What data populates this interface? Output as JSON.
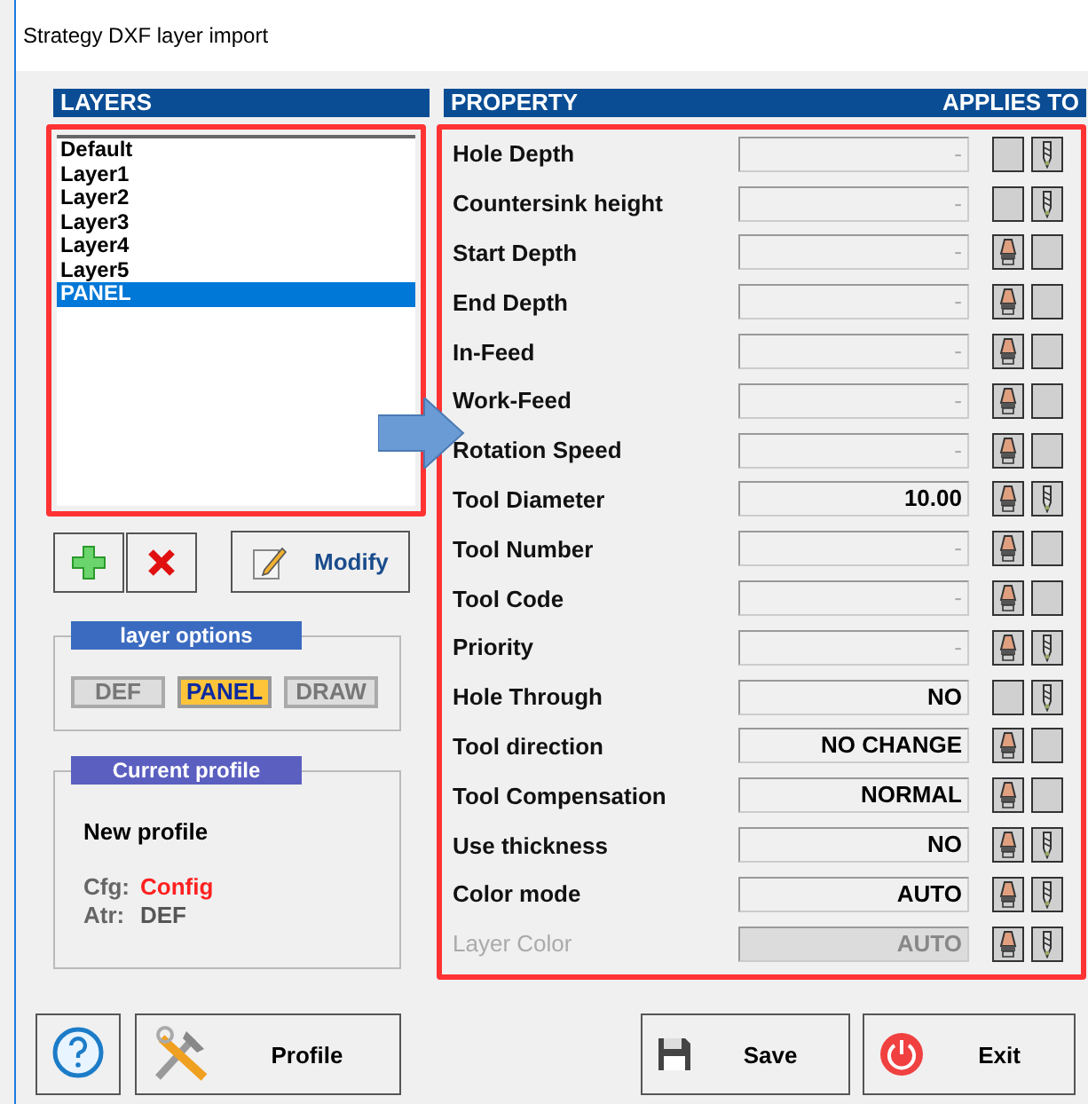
{
  "window": {
    "title": "Strategy DXF layer import"
  },
  "layers": {
    "header": "LAYERS",
    "items": [
      {
        "label": "Default",
        "selected": false
      },
      {
        "label": "Layer1",
        "selected": false
      },
      {
        "label": "Layer2",
        "selected": false
      },
      {
        "label": "Layer3",
        "selected": false
      },
      {
        "label": "Layer4",
        "selected": false
      },
      {
        "label": "Layer5",
        "selected": false
      },
      {
        "label": "PANEL",
        "selected": true
      }
    ]
  },
  "layer_buttons": {
    "modify": "Modify"
  },
  "layer_options": {
    "title": "layer options",
    "options": [
      {
        "label": "DEF",
        "selected": false
      },
      {
        "label": "PANEL",
        "selected": true
      },
      {
        "label": "DRAW",
        "selected": false
      }
    ]
  },
  "current_profile": {
    "title": "Current profile",
    "name": "New profile",
    "fields": [
      {
        "label": "Cfg:",
        "value": "Config",
        "color": "#ff2020"
      },
      {
        "label": "Atr:",
        "value": "DEF",
        "color": "#555555"
      }
    ]
  },
  "properties": {
    "header": "PROPERTY",
    "applies_header": "APPLIES TO",
    "rows": [
      {
        "label": "Hole Depth",
        "placeholder": "-",
        "panel": false,
        "drill": true,
        "disabled": false
      },
      {
        "label": "Countersink height",
        "placeholder": "-",
        "panel": false,
        "drill": true,
        "disabled": false
      },
      {
        "label": "Start Depth",
        "placeholder": "-",
        "panel": true,
        "drill": false,
        "disabled": false
      },
      {
        "label": "End Depth",
        "placeholder": "-",
        "panel": true,
        "drill": false,
        "disabled": false
      },
      {
        "label": "In-Feed",
        "placeholder": "-",
        "panel": true,
        "drill": false,
        "disabled": false
      },
      {
        "label": "Work-Feed",
        "placeholder": "-",
        "panel": true,
        "drill": false,
        "disabled": false
      },
      {
        "label": "Rotation Speed",
        "placeholder": "-",
        "panel": true,
        "drill": false,
        "disabled": false
      },
      {
        "label": "Tool Diameter",
        "value": "10.00",
        "panel": true,
        "drill": true,
        "disabled": false
      },
      {
        "label": "Tool Number",
        "placeholder": "-",
        "panel": true,
        "drill": false,
        "disabled": false
      },
      {
        "label": "Tool Code",
        "placeholder": "-",
        "panel": true,
        "drill": false,
        "disabled": false
      },
      {
        "label": "Priority",
        "placeholder": "-",
        "panel": true,
        "drill": true,
        "disabled": false
      },
      {
        "label": "Hole Through",
        "value": "NO",
        "panel": false,
        "drill": true,
        "disabled": false
      },
      {
        "label": "Tool direction",
        "value": "NO CHANGE",
        "panel": true,
        "drill": false,
        "disabled": false
      },
      {
        "label": "Tool Compensation",
        "value": "NORMAL",
        "panel": true,
        "drill": false,
        "disabled": false
      },
      {
        "label": "Use thickness",
        "value": "NO",
        "panel": true,
        "drill": true,
        "disabled": false
      },
      {
        "label": "Color mode",
        "value": "AUTO",
        "panel": true,
        "drill": true,
        "disabled": false
      },
      {
        "label": "Layer Color",
        "value": "AUTO",
        "panel": true,
        "drill": true,
        "disabled": true
      }
    ]
  },
  "buttons": [
    {
      "kind": "help"
    },
    {
      "kind": "profile",
      "label": "Profile"
    },
    {
      "kind": "save",
      "label": "Save"
    },
    {
      "kind": "exit",
      "label": "Exit"
    }
  ]
}
